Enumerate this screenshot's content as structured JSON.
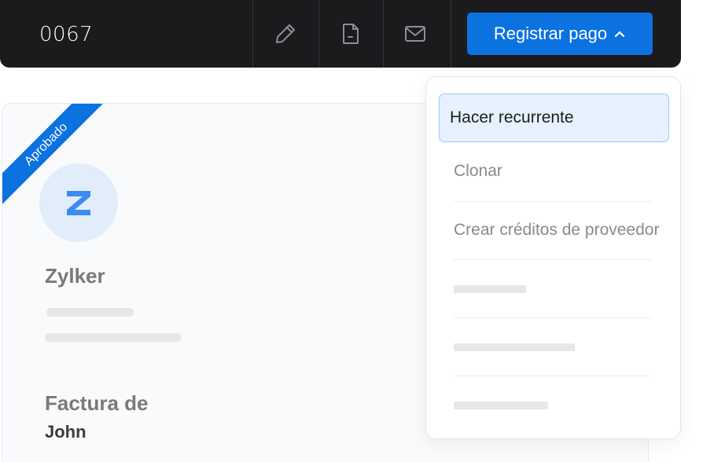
{
  "toolbar": {
    "doc_number": "0067",
    "icons": [
      "edit-icon",
      "pdf-file-icon",
      "mail-icon"
    ],
    "primary_button": {
      "label": "Registrar pago",
      "icon": "chevron-up-icon"
    }
  },
  "card": {
    "status_ribbon": "Aprobado",
    "avatar_icon": "zylker-logo-icon",
    "company_name": "Zylker",
    "section_label": "Factura de",
    "section_value": "John"
  },
  "dropdown": {
    "items": [
      {
        "label": "Hacer recurrente",
        "active": true
      },
      {
        "label": "Clonar",
        "active": false
      },
      {
        "label": "Crear créditos de proveedor",
        "active": false
      }
    ]
  },
  "colors": {
    "toolbar_bg": "#1b1b1d",
    "accent": "#0b72e0",
    "active_item_bg": "#e6f1ff",
    "active_item_border": "#9cc7f5",
    "card_bg": "#f9fafc",
    "skeleton": "#e7e7e9"
  }
}
